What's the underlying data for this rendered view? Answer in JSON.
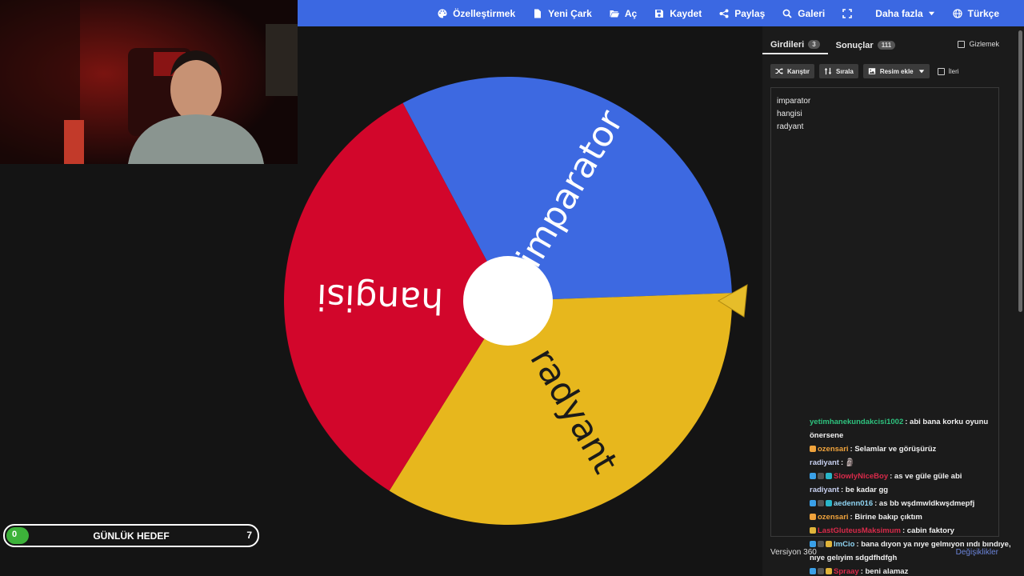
{
  "nav": {
    "items": [
      {
        "label": "Özelleştirmek",
        "icon": "palette-icon"
      },
      {
        "label": "Yeni Çark",
        "icon": "file-icon"
      },
      {
        "label": "Aç",
        "icon": "folder-open-icon"
      },
      {
        "label": "Kaydet",
        "icon": "save-icon"
      },
      {
        "label": "Paylaş",
        "icon": "share-icon"
      },
      {
        "label": "Galeri",
        "icon": "search-icon"
      },
      {
        "label": "",
        "icon": "fullscreen-icon"
      },
      {
        "label": "Daha fazla",
        "icon": "chevron-down-icon"
      },
      {
        "label": "Türkçe",
        "icon": "globe-icon"
      }
    ]
  },
  "wheel": {
    "segments": [
      {
        "label": "imparator",
        "color": "#3d69e1"
      },
      {
        "label": "radyant",
        "color": "#e7b71d"
      },
      {
        "label": "hangisi",
        "color": "#d2062b"
      }
    ],
    "pointer_color": "#e6bd2a",
    "hub_color": "#ffffff"
  },
  "panel": {
    "tabs": [
      {
        "label": "Girdileri",
        "count": "3"
      },
      {
        "label": "Sonuçlar",
        "count": "111"
      }
    ],
    "hide_label": "Gizlemek",
    "toolbar": {
      "shuffle_label": "Karıştır",
      "sort_label": "Sırala",
      "image_label": "Resim ekle",
      "advanced_label": "İleri"
    },
    "entries": [
      "imparator",
      "hangisi",
      "radyant"
    ],
    "version": "Versiyon 360",
    "changes_label": "Değişiklikler"
  },
  "chat": {
    "messages": [
      {
        "user": "yetimhanekundakcisi1002",
        "user_color": "#2ec27e",
        "text": ": abi bana korku oyunu önersene",
        "badges": []
      },
      {
        "user": "ozensari",
        "user_color": "#f0a33c",
        "text": ": Selamlar ve görüşürüz",
        "badges": [
          "#f0a33c"
        ]
      },
      {
        "user": "radiyant",
        "user_color": "#c8d0f0",
        "text": ": 🗿",
        "badges": []
      },
      {
        "user": "SlowlyNiceBoy",
        "user_color": "#d92a4a",
        "text": ": as ve güle güle abi",
        "badges": [
          "#3aa0e8",
          "#555555",
          "#29b6c9"
        ]
      },
      {
        "user": "radiyant",
        "user_color": "#c8d0f0",
        "text": ": be kadar gg",
        "badges": []
      },
      {
        "user": "aedenn016",
        "user_color": "#8fd4f2",
        "text": ": as bb wşdmwldkwşdmepfj",
        "badges": [
          "#3aa0e8",
          "#555555",
          "#29b6c9"
        ]
      },
      {
        "user": "ozensari",
        "user_color": "#f0a33c",
        "text": ": Birine bakıp çıktım",
        "badges": [
          "#f0a33c"
        ]
      },
      {
        "user": "LastGluteusMaksimum",
        "user_color": "#d92a4a",
        "text": ": cabin faktory",
        "badges": [
          "#e0b43a"
        ]
      },
      {
        "user": "ImCio",
        "user_color": "#8fd4f2",
        "text": ": bana dıyon ya nıye gelmıyon ındı bındıye, nıye gelıyim sdgdfhdfgh",
        "badges": [
          "#3aa0e8",
          "#555555",
          "#e0b43a"
        ]
      },
      {
        "user": "Spraay",
        "user_color": "#d92a4a",
        "text": ": beni alamaz",
        "badges": [
          "#3aa0e8",
          "#555555",
          "#e0b43a"
        ]
      }
    ]
  },
  "goal": {
    "title": "GÜNLÜK HEDEF",
    "start": "0",
    "target": "7",
    "progress": 0
  },
  "colors": {
    "topbar": "#3b68e2",
    "goal_fill": "#3db23a"
  }
}
